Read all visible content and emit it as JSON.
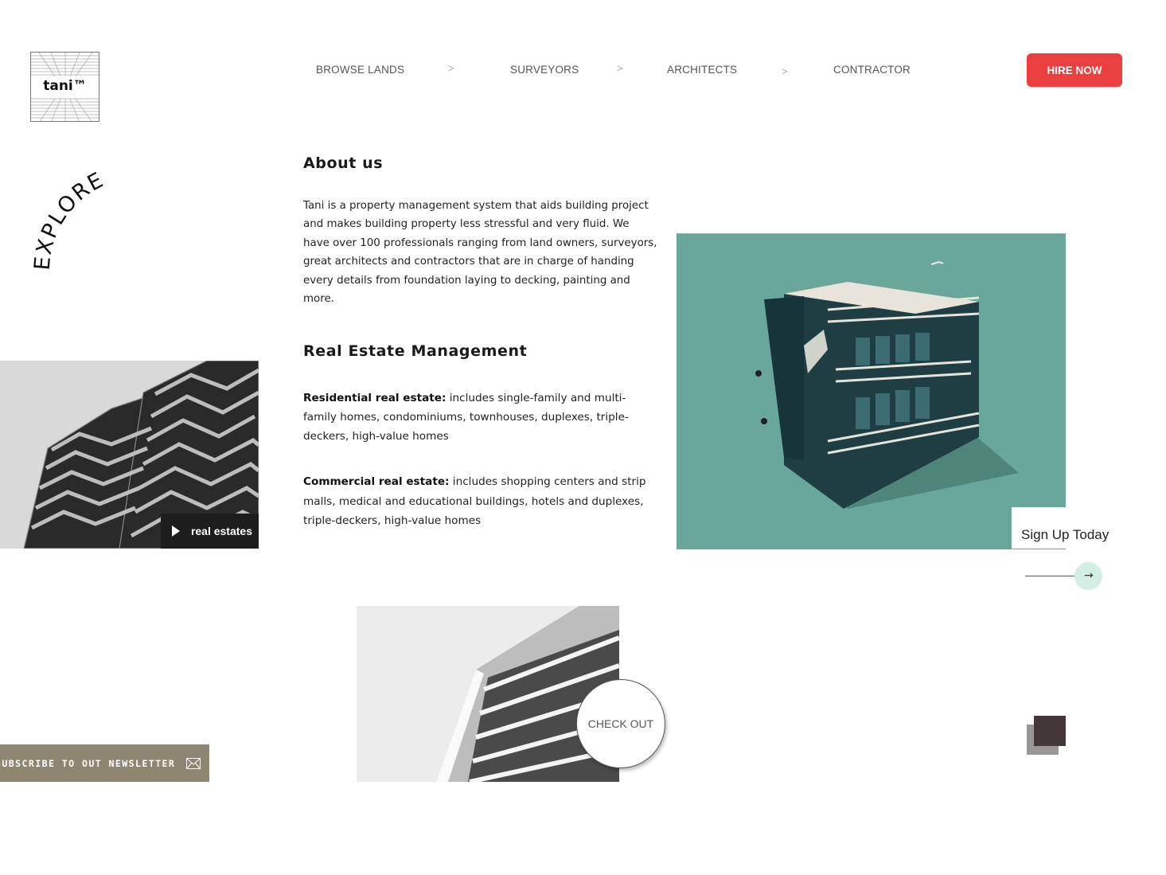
{
  "header": {
    "logo_text": "tani™",
    "nav": [
      {
        "label": "BROWSE LANDS"
      },
      {
        "label": "SURVEYORS"
      },
      {
        "label": "ARCHITECTS"
      },
      {
        "label": "CONTRACTOR"
      }
    ],
    "nav_separator": ">",
    "hire_label": "HIRE NOW"
  },
  "explore_text": "EXPLORE",
  "about": {
    "title": "About us",
    "body": "Tani is a property management system that aids building project and makes building property less stressful and very fluid. We have over 100 professionals ranging from land owners, surveyors, great architects and contractors that are in charge of handing every details from foundation laying to decking, painting and more."
  },
  "management": {
    "title": "Real Estate Management",
    "residential_label": "Residential real estate:",
    "residential_text": " includes single-family and multi-family homes, condominiums, townhouses, duplexes, triple-deckers, high-value homes",
    "commercial_label": "Commercial real estate:",
    "commercial_text": " includes shopping centers and strip malls, medical and educational buildings, hotels and duplexes, triple-deckers, high-value homes"
  },
  "real_estates_label": "real estates",
  "signup_label": "Sign Up Today",
  "checkout_label": "CHECK OUT",
  "newsletter_label": "SUBSCRIBE TO OUT NEWSLETTER",
  "colors": {
    "accent": "#ea3f3f",
    "teal": "#68a79a",
    "newsletter_bg": "#8d8671",
    "arrow_circle": "#d3efe3"
  },
  "icons": [
    "play-icon",
    "arrow-right-icon",
    "mail-icon"
  ]
}
